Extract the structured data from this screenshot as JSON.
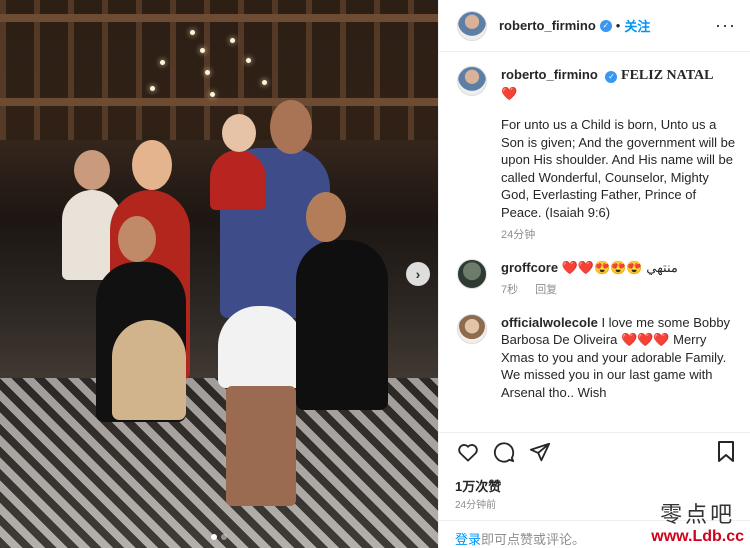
{
  "post": {
    "image_alt": "family photo",
    "carousel": {
      "next_icon": "chevron-right-icon",
      "dot_count": 2,
      "active_dot": 1
    }
  },
  "header": {
    "username": "roberto_firmino",
    "verified_icon": "verified-badge-icon",
    "separator": "•",
    "follow_label": "关注",
    "more_icon": "more-horizontal-icon",
    "more_label": "···"
  },
  "caption": {
    "username": "roberto_firmino",
    "title": "FELIZ NATAL",
    "heart": "❤️",
    "text": "For unto us a Child is born, Unto us a Son is given; And the government will be upon His shoulder. And His name will be called Wonderful, Counselor, Mighty God, Everlasting Father, Prince of Peace. (Isaiah 9:6)",
    "time": "24分钟"
  },
  "comments": [
    {
      "username": "groffcore",
      "text": "❤️❤️😍😍😍 منتهي",
      "time": "7秒",
      "reply_label": "回复"
    },
    {
      "username": "officialwolecole",
      "text": "I love me some Bobby Barbosa De Oliveira ❤️❤️❤️ Merry Xmas to you and your adorable Family. We missed you in our last game with Arsenal tho.. Wish"
    }
  ],
  "actions": {
    "like_icon": "heart-outline-icon",
    "comment_icon": "comment-bubble-icon",
    "share_icon": "paper-plane-icon",
    "save_icon": "bookmark-icon"
  },
  "likes_label": "1万次赞",
  "time_ago": "24分钟前",
  "login_bar": {
    "link": "登录",
    "text": "即可点赞或评论。"
  },
  "watermark": {
    "cn": "零点吧",
    "url": "www.Ldb.cc"
  }
}
